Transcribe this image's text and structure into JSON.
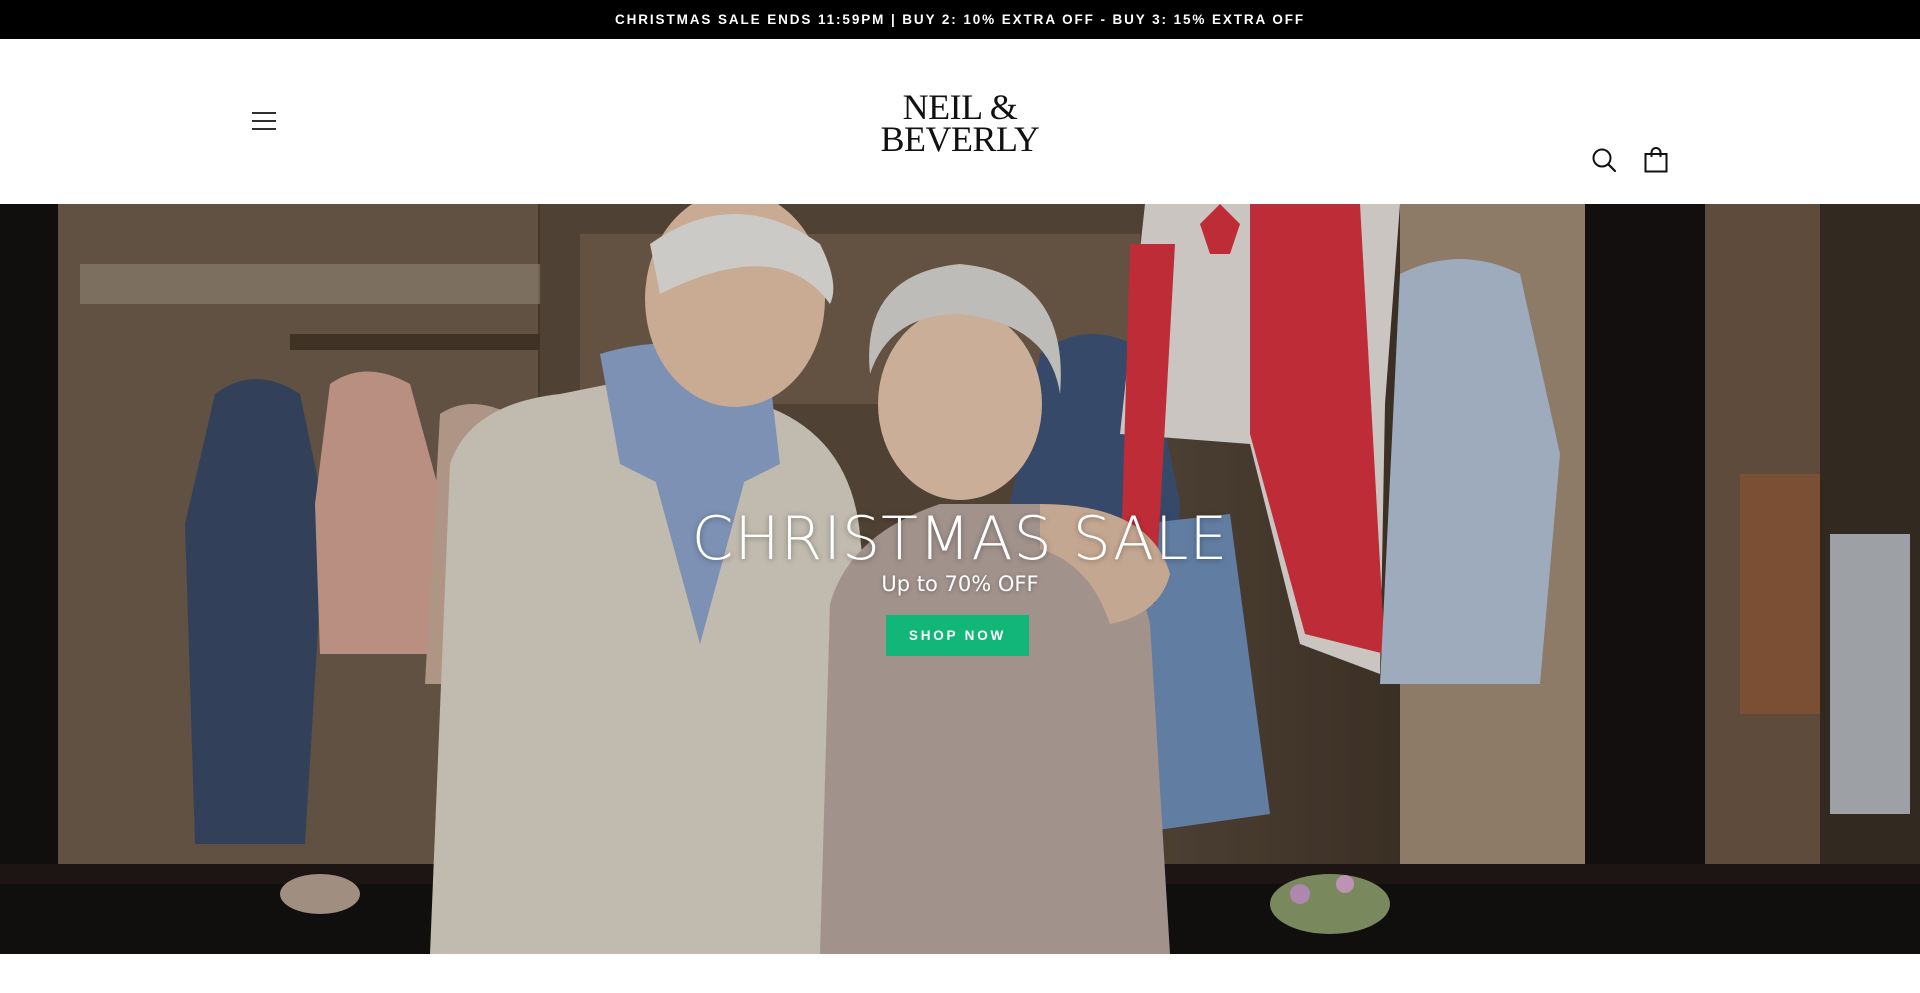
{
  "announcement": {
    "text": "CHRISTMAS SALE ENDS 11:59PM | BUY 2: 10% EXTRA OFF - BUY 3: 15% EXTRA OFF"
  },
  "header": {
    "logo_line1": "NEIL &",
    "logo_line2": "BEVERLY",
    "menu_icon": "hamburger-menu-icon",
    "search_icon": "search-icon",
    "cart_icon": "shopping-bag-icon"
  },
  "hero": {
    "title": "CHRISTMAS SALE",
    "subtitle": "Up to 70% OFF",
    "cta_label": "SHOP NOW"
  },
  "colors": {
    "announcement_bg": "#000000",
    "cta_bg": "#11b678",
    "text_light": "#ffffff"
  }
}
